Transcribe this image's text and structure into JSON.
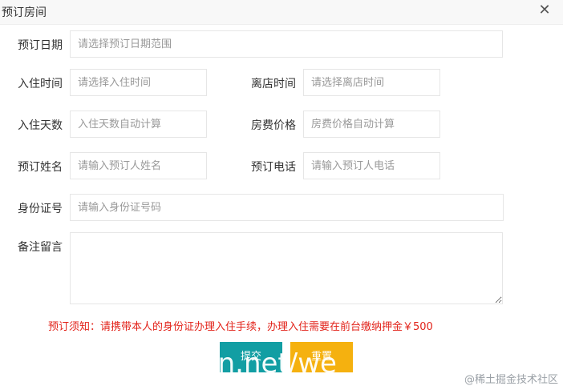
{
  "dialog": {
    "title": "预订房间",
    "close_icon": "close-icon",
    "close_glyph": "✕"
  },
  "form": {
    "booking_date": {
      "label": "预订日期",
      "placeholder": "请选择预订日期范围"
    },
    "checkin_time": {
      "label": "入住时间",
      "placeholder": "请选择入住时间"
    },
    "checkout_time": {
      "label": "离店时间",
      "placeholder": "请选择离店时间"
    },
    "stay_days": {
      "label": "入住天数",
      "placeholder": "入住天数自动计算"
    },
    "room_price": {
      "label": "房费价格",
      "placeholder": "房费价格自动计算"
    },
    "booker_name": {
      "label": "预订姓名",
      "placeholder": "请输入预订人姓名"
    },
    "booker_phone": {
      "label": "预订电话",
      "placeholder": "请输入预订人电话"
    },
    "id_number": {
      "label": "身份证号",
      "placeholder": "请输入身份证号码"
    },
    "remarks": {
      "label": "备注留言",
      "placeholder": ""
    }
  },
  "notice": "预订须知：请携带本人的身份证办理入住手续，办理入住需要在前台缴纳押金￥500",
  "buttons": {
    "submit": "提交",
    "reset": "重置"
  },
  "overlay_watermark": "dn.net/we",
  "credit": "@稀土掘金技术社区",
  "colors": {
    "submit_bg": "#129ea3",
    "reset_bg": "#f5b10f",
    "notice_text": "#e2231a",
    "border": "#e6e6e6"
  }
}
